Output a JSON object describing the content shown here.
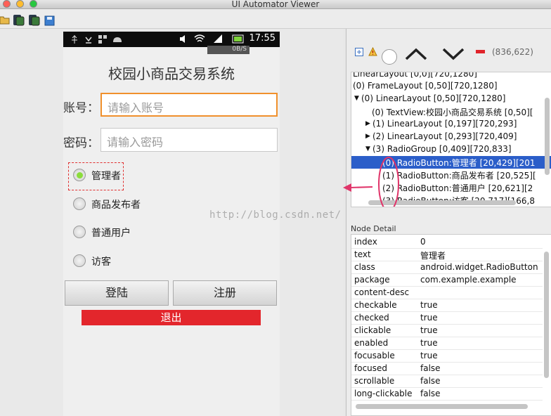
{
  "window": {
    "title": "UI Automator Viewer"
  },
  "toolbar": {
    "icons": [
      "open-folder-icon",
      "device-screenshot-icon",
      "device-screenshot-compressed-icon",
      "save-icon"
    ]
  },
  "device": {
    "statusbar": {
      "time": "17:55",
      "net_speed": "0B/S"
    },
    "app_title": "校园小商品交易系统",
    "account": {
      "label": "账号：",
      "placeholder": "请输入账号"
    },
    "password": {
      "label": "密码：",
      "placeholder": "请输入密码"
    },
    "radios": [
      {
        "label": "管理者",
        "checked": true
      },
      {
        "label": "商品发布者",
        "checked": false
      },
      {
        "label": "普通用户",
        "checked": false
      },
      {
        "label": "访客",
        "checked": false
      }
    ],
    "login_button": "登陆",
    "register_button": "注册",
    "exit_button": "退出"
  },
  "hierarchy": {
    "coords": "(836,622)",
    "rows": [
      {
        "text": "LinearLayout [0,0][720,1280]",
        "selected": false
      },
      {
        "text": "(0) FrameLayout [0,50][720,1280]",
        "selected": false
      },
      {
        "text": "(0) LinearLayout [0,50][720,1280]",
        "selected": false
      },
      {
        "text": "(0) TextView:校园小商品交易系统 [0,50][",
        "selected": false
      },
      {
        "text": "(1) LinearLayout [0,197][720,293]",
        "selected": false
      },
      {
        "text": "(2) LinearLayout [0,293][720,409]",
        "selected": false
      },
      {
        "text": "(3) RadioGroup [0,409][720,833]",
        "selected": false
      },
      {
        "text": "(0) RadioButton:管理者 [20,429][201",
        "selected": true
      },
      {
        "text": "(1) RadioButton:商品发布者 [20,525][",
        "selected": false
      },
      {
        "text": "(2) RadioButton:普通用户 [20,621][2",
        "selected": false
      },
      {
        "text": "(3) RadioButton:访客 [20,717][166,8",
        "selected": false
      }
    ]
  },
  "node_detail": {
    "title": "Node Detail",
    "rows": [
      {
        "key": "index",
        "value": "0"
      },
      {
        "key": "text",
        "value": "管理者"
      },
      {
        "key": "class",
        "value": "android.widget.RadioButton"
      },
      {
        "key": "package",
        "value": "com.example.example"
      },
      {
        "key": "content-desc",
        "value": ""
      },
      {
        "key": "checkable",
        "value": "true"
      },
      {
        "key": "checked",
        "value": "true"
      },
      {
        "key": "clickable",
        "value": "true"
      },
      {
        "key": "enabled",
        "value": "true"
      },
      {
        "key": "focusable",
        "value": "true"
      },
      {
        "key": "focused",
        "value": "false"
      },
      {
        "key": "scrollable",
        "value": "false"
      },
      {
        "key": "long-clickable",
        "value": "false"
      }
    ]
  },
  "watermark": "http://blog.csdn.net/"
}
